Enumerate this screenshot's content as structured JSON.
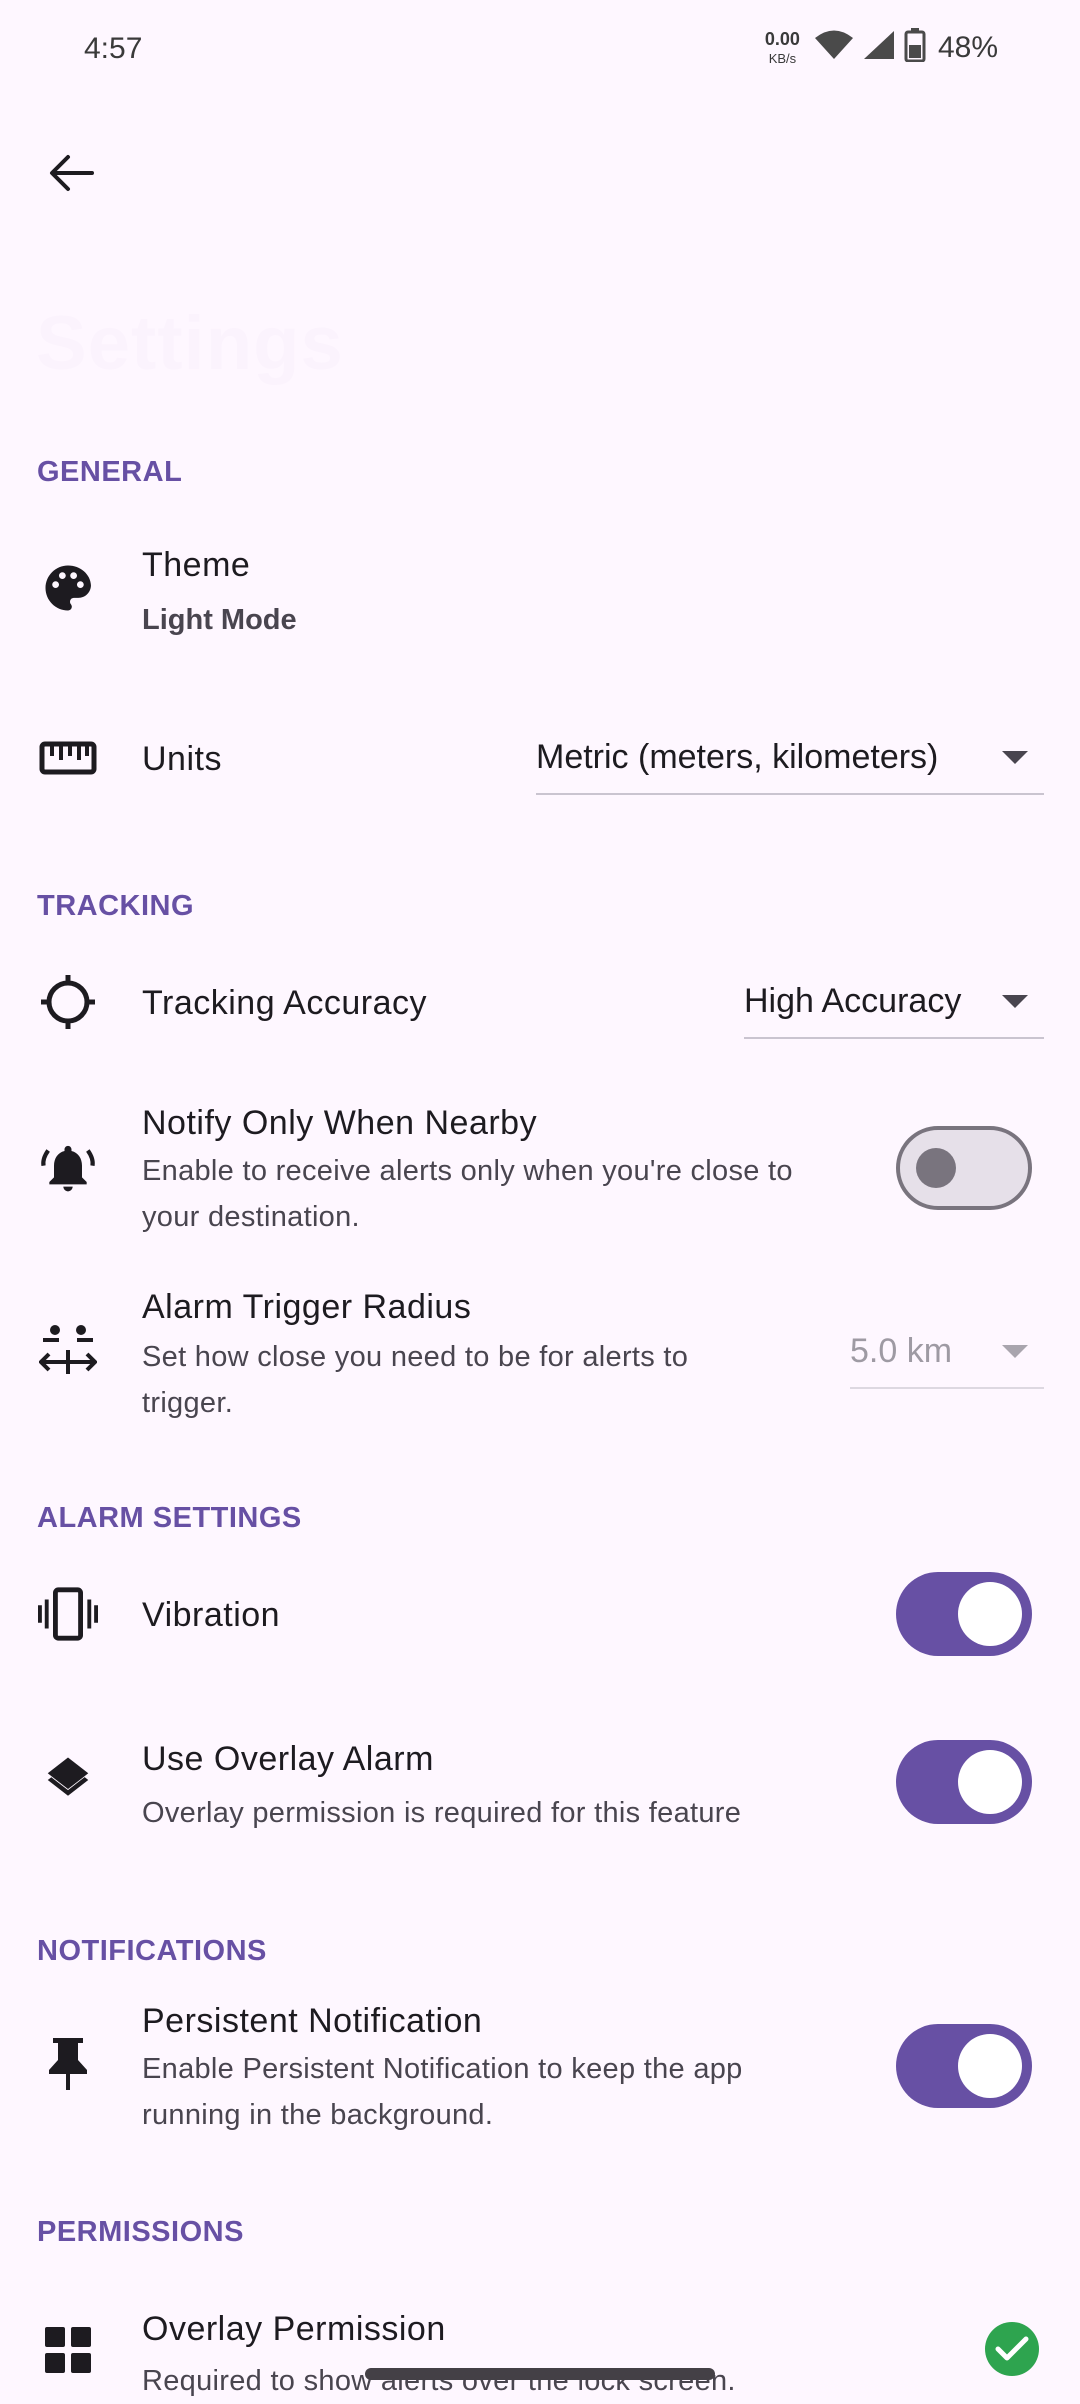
{
  "status_bar": {
    "time": "4:57",
    "net_speed_value": "0.00",
    "net_speed_unit": "KB/s",
    "battery": "48%"
  },
  "header": {
    "title": "Settings"
  },
  "sections": {
    "general": "GENERAL",
    "tracking": "TRACKING",
    "alarm_settings": "ALARM SETTINGS",
    "notifications": "NOTIFICATIONS",
    "permissions": "PERMISSIONS"
  },
  "theme": {
    "title": "Theme",
    "value": "Light Mode"
  },
  "units": {
    "title": "Units",
    "value": "Metric (meters, kilometers)"
  },
  "tracking_accuracy": {
    "title": "Tracking Accuracy",
    "value": "High Accuracy"
  },
  "notify_nearby": {
    "title": "Notify Only When Nearby",
    "subtitle": "Enable to receive alerts only when you're close to your destination.",
    "enabled": false
  },
  "alarm_radius": {
    "title": "Alarm Trigger Radius",
    "subtitle": "Set how close you need to be for alerts to trigger.",
    "value": "5.0 km"
  },
  "vibration": {
    "title": "Vibration",
    "enabled": true
  },
  "overlay_alarm": {
    "title": "Use Overlay Alarm",
    "subtitle": "Overlay permission is required for this feature",
    "enabled": true
  },
  "persistent_notification": {
    "title": "Persistent Notification",
    "subtitle": "Enable Persistent Notification to keep the app running in the background.",
    "enabled": true
  },
  "overlay_permission": {
    "title": "Overlay Permission",
    "subtitle": "Required to show alerts over the lock screen."
  },
  "colors": {
    "accent": "#6750a4",
    "background": "#fef7ff",
    "granted": "#2ea44f"
  }
}
